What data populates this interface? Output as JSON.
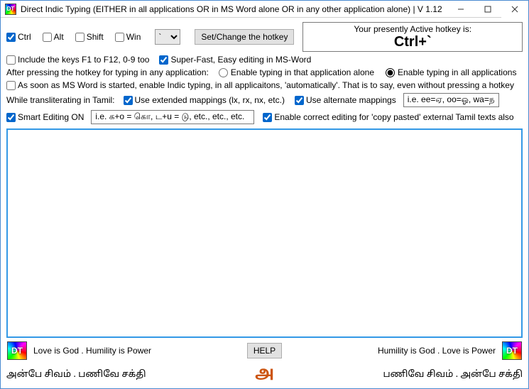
{
  "window": {
    "title": "Direct Indic Typing (EITHER in all applications OR in MS Word alone OR in any other application alone) | V 1.12"
  },
  "modifiers": {
    "ctrl": "Ctrl",
    "alt": "Alt",
    "shift": "Shift",
    "win": "Win"
  },
  "modifier_state": {
    "ctrl": true,
    "alt": false,
    "shift": false,
    "win": false
  },
  "hotkey_char": "`",
  "set_hotkey_btn": "Set/Change the hotkey",
  "active_hotkey_label": "Your presently Active hotkey is:",
  "active_hotkey_value": "Ctrl+`",
  "include_f_keys_label": "Include the keys F1 to F12, 0-9 too",
  "include_f_keys_checked": false,
  "superfast_label": "Super-Fast, Easy editing in MS-Word",
  "superfast_checked": true,
  "after_pressing_label": "After pressing the hotkey for typing in any application:",
  "radio_single": "Enable typing in that application alone",
  "radio_all": "Enable typing in all applications",
  "radio_selected": "all",
  "auto_start_label": "As soon as MS Word is started, enable Indic typing, in all applicaitons, 'automatically'. That is to say, even without pressing a hotkey",
  "auto_start_checked": false,
  "tamil_section_label": "While transliterating in Tamil:",
  "extended_mappings_label": "Use extended mappings (lx, rx, nx, etc.)",
  "extended_mappings_checked": true,
  "alternate_mappings_label": "Use alternate mappings",
  "alternate_mappings_checked": true,
  "alternate_hint": "i.e. ee=ஏ, oo=ஓ, wa=ந",
  "smart_editing_label": "Smart Editing ON",
  "smart_editing_checked": true,
  "smart_editing_hint": "i.e. க+o = கொ, ட+u = டு, etc., etc., etc.",
  "copy_pasted_label": "Enable correct editing for 'copy pasted' external Tamil texts also",
  "copy_pasted_checked": true,
  "editor_text": "",
  "help_btn": "HELP",
  "footer_en_left": "Love is God . Humility is Power",
  "footer_en_right": "Humility is God . Love is Power",
  "footer_ta_left": "அன்பே சிவம் . பணிவே சக்தி",
  "footer_ta_right": "பணிவே சிவம் . அன்பே சக்தி",
  "logo_text": "DT",
  "tamil_center_glyph": "அ"
}
